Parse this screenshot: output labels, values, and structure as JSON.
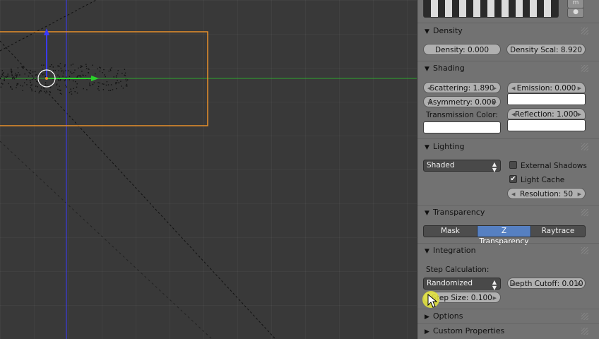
{
  "preview": {
    "button_top": "m",
    "button_bottom": "●"
  },
  "sections": {
    "density": {
      "title": "Density",
      "density": "Density: 0.000",
      "density_scale": "Density Scal: 8.920"
    },
    "shading": {
      "title": "Shading",
      "scattering": "Scattering: 1.890",
      "asymmetry": "Asymmetry: 0.000",
      "emission": "Emission: 0.000",
      "transmission_color_label": "Transmission Color:",
      "reflection": "Reflection: 1.000"
    },
    "lighting": {
      "title": "Lighting",
      "mode": "Shaded",
      "external_shadows": "External Shadows",
      "light_cache": "Light Cache",
      "resolution": "Resolution: 50"
    },
    "transparency": {
      "title": "Transparency",
      "options": [
        "Mask",
        "Z Transparency",
        "Raytrace"
      ],
      "active": "Z Transparency"
    },
    "integration": {
      "title": "Integration",
      "step_calc_label": "Step Calculation:",
      "step_calc": "Randomized",
      "depth_cutoff": "Depth Cutoff: 0.010",
      "step_size": "Step Size: 0.100"
    },
    "options": {
      "title": "Options"
    },
    "custom_properties": {
      "title": "Custom Properties"
    }
  },
  "colors": {
    "panel_bg": "#727272",
    "viewport_bg": "#393939",
    "selection_orange": "#e8902a",
    "x_axis": "#3fbf3f",
    "y_axis": "#3a3aff",
    "active_tab": "#5680c2"
  },
  "icons": {
    "collapse": "triangle-down-icon",
    "expand": "triangle-right-icon",
    "check": "checkmark-icon"
  }
}
